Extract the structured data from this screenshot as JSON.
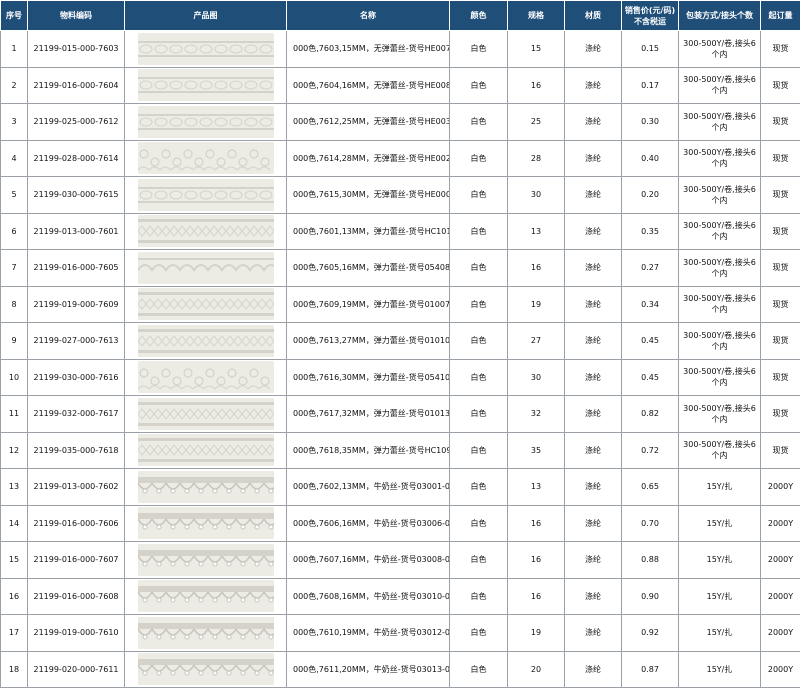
{
  "headers": [
    "序号",
    "物料编码",
    "产品图",
    "名称",
    "颜色",
    "规格",
    "材质",
    "销售价(元/码)\n不含税运",
    "包装方式/接头个数",
    "起订量"
  ],
  "rows": [
    {
      "no": "1",
      "code": "21199-015-000-7603",
      "name": "000色,7603,15MM，无弹蕾丝-货号HE0076-15-000",
      "color": "白色",
      "spec": "15",
      "material": "涤纶",
      "price": "0.15",
      "pack": "300-500Y/卷,接头6个内",
      "moq": "现货",
      "style": "plain"
    },
    {
      "no": "2",
      "code": "21199-016-000-7604",
      "name": "000色,7604,16MM，无弹蕾丝-货号HE0087-16-000",
      "color": "白色",
      "spec": "16",
      "material": "涤纶",
      "price": "0.17",
      "pack": "300-500Y/卷,接头6个内",
      "moq": "现货",
      "style": "plain"
    },
    {
      "no": "3",
      "code": "21199-025-000-7612",
      "name": "000色,7612,25MM，无弹蕾丝-货号HE0036-25-000",
      "color": "白色",
      "spec": "25",
      "material": "涤纶",
      "price": "0.30",
      "pack": "300-500Y/卷,接头6个内",
      "moq": "现货",
      "style": "plain"
    },
    {
      "no": "4",
      "code": "21199-028-000-7614",
      "name": "000色,7614,28MM，无弹蕾丝-货号HE0026-28-000",
      "color": "白色",
      "spec": "28",
      "material": "涤纶",
      "price": "0.40",
      "pack": "300-500Y/卷,接头6个内",
      "moq": "现货",
      "style": "floral"
    },
    {
      "no": "5",
      "code": "21199-030-000-7615",
      "name": "000色,7615,30MM，无弹蕾丝-货号HE0009-30-000",
      "color": "白色",
      "spec": "30",
      "material": "涤纶",
      "price": "0.20",
      "pack": "300-500Y/卷,接头6个内",
      "moq": "现货",
      "style": "plain"
    },
    {
      "no": "6",
      "code": "21199-013-000-7601",
      "name": "000色,7601,13MM，弹力蕾丝-货号HC1019-13-000",
      "color": "白色",
      "spec": "13",
      "material": "涤纶",
      "price": "0.35",
      "pack": "300-500Y/卷,接头6个内",
      "moq": "现货",
      "style": "elastic"
    },
    {
      "no": "7",
      "code": "21199-016-000-7605",
      "name": "000色,7605,16MM，弹力蕾丝-货号05408-016-000",
      "color": "白色",
      "spec": "16",
      "material": "涤纶",
      "price": "0.27",
      "pack": "300-500Y/卷,接头6个内",
      "moq": "现货",
      "style": "wave"
    },
    {
      "no": "8",
      "code": "21199-019-000-7609",
      "name": "000色,7609,19MM，弹力蕾丝-货号01007-019-000",
      "color": "白色",
      "spec": "19",
      "material": "涤纶",
      "price": "0.34",
      "pack": "300-500Y/卷,接头6个内",
      "moq": "现货",
      "style": "elastic"
    },
    {
      "no": "9",
      "code": "21199-027-000-7613",
      "name": "000色,7613,27MM，弹力蕾丝-货号01010-027-000",
      "color": "白色",
      "spec": "27",
      "material": "涤纶",
      "price": "0.45",
      "pack": "300-500Y/卷,接头6个内",
      "moq": "现货",
      "style": "elastic"
    },
    {
      "no": "10",
      "code": "21199-030-000-7616",
      "name": "000色,7616,30MM，弹力蕾丝-货号05410-030-000",
      "color": "白色",
      "spec": "30",
      "material": "涤纶",
      "price": "0.45",
      "pack": "300-500Y/卷,接头6个内",
      "moq": "现货",
      "style": "floral"
    },
    {
      "no": "11",
      "code": "21199-032-000-7617",
      "name": "000色,7617,32MM，弹力蕾丝-货号01013-032-000",
      "color": "白色",
      "spec": "32",
      "material": "涤纶",
      "price": "0.82",
      "pack": "300-500Y/卷,接头6个内",
      "moq": "现货",
      "style": "elastic"
    },
    {
      "no": "12",
      "code": "21199-035-000-7618",
      "name": "000色,7618,35MM，弹力蕾丝-货号HC1091-35-000",
      "color": "白色",
      "spec": "35",
      "material": "涤纶",
      "price": "0.72",
      "pack": "300-500Y/卷,接头6个内",
      "moq": "现货",
      "style": "elastic"
    },
    {
      "no": "13",
      "code": "21199-013-000-7602",
      "name": "000色,7602,13MM，牛奶丝-货号03001-013-000",
      "color": "白色",
      "spec": "13",
      "material": "涤纶",
      "price": "0.65",
      "pack": "15Y/扎",
      "moq": "2000Y",
      "style": "scallop"
    },
    {
      "no": "14",
      "code": "21199-016-000-7606",
      "name": "000色,7606,16MM，牛奶丝-货号03006-016-000",
      "color": "白色",
      "spec": "16",
      "material": "涤纶",
      "price": "0.70",
      "pack": "15Y/扎",
      "moq": "2000Y",
      "style": "scallop"
    },
    {
      "no": "15",
      "code": "21199-016-000-7607",
      "name": "000色,7607,16MM，牛奶丝-货号03008-016-000",
      "color": "白色",
      "spec": "16",
      "material": "涤纶",
      "price": "0.88",
      "pack": "15Y/扎",
      "moq": "2000Y",
      "style": "scallop"
    },
    {
      "no": "16",
      "code": "21199-016-000-7608",
      "name": "000色,7608,16MM，牛奶丝-货号03010-016-000",
      "color": "白色",
      "spec": "16",
      "material": "涤纶",
      "price": "0.90",
      "pack": "15Y/扎",
      "moq": "2000Y",
      "style": "scallop"
    },
    {
      "no": "17",
      "code": "21199-019-000-7610",
      "name": "000色,7610,19MM，牛奶丝-货号03012-019-000",
      "color": "白色",
      "spec": "19",
      "material": "涤纶",
      "price": "0.92",
      "pack": "15Y/扎",
      "moq": "2000Y",
      "style": "scallop"
    },
    {
      "no": "18",
      "code": "21199-020-000-7611",
      "name": "000色,7611,20MM，牛奶丝-货号03013-020-000",
      "color": "白色",
      "spec": "20",
      "material": "涤纶",
      "price": "0.87",
      "pack": "15Y/扎",
      "moq": "2000Y",
      "style": "scallop"
    }
  ],
  "colors": {
    "header_bg": "#1f4e79",
    "header_text": "#ffffff",
    "grid": "#9aa0a6",
    "lace_base": "#ecebe4",
    "lace_pattern": "#d4d2c9"
  }
}
